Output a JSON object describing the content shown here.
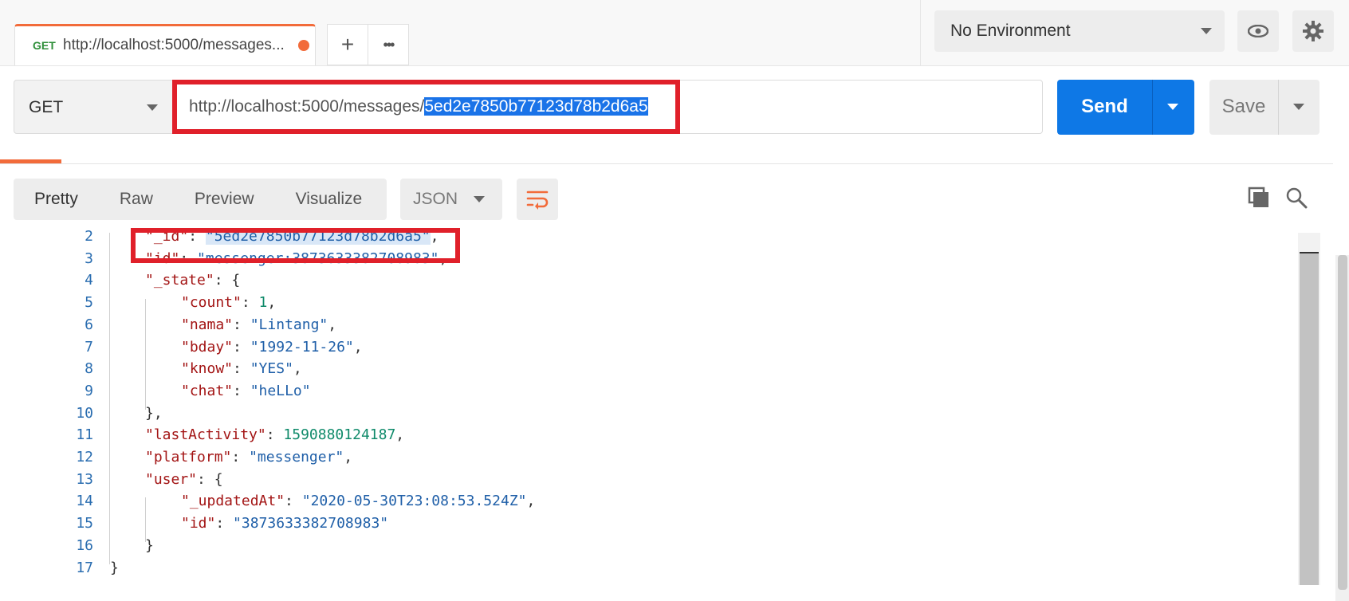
{
  "tab": {
    "method": "GET",
    "url": "http://localhost:5000/messages..."
  },
  "tab_actions": {
    "add_label": "+",
    "more_label": "•••"
  },
  "environment": {
    "selected": "No Environment"
  },
  "request": {
    "method": "GET",
    "url_base": "http://localhost:5000/messages/",
    "url_selected": "5ed2e7850b77123d78b2d6a5",
    "send_label": "Send",
    "save_label": "Save"
  },
  "response": {
    "view_tabs": [
      "Pretty",
      "Raw",
      "Preview",
      "Visualize"
    ],
    "active_view": "Pretty",
    "format": "JSON"
  },
  "code_lines": [
    {
      "num": "2",
      "parts": [
        [
          "\"_id\"",
          "k"
        ],
        [
          ": ",
          "p"
        ],
        [
          "\"5ed2e7850b77123d78b2d6a5\"",
          "s"
        ],
        [
          ",",
          "p"
        ]
      ],
      "indent": 1
    },
    {
      "num": "3",
      "parts": [
        [
          "\"id\"",
          "k"
        ],
        [
          ": ",
          "p"
        ],
        [
          "\"messenger:3873633382708983\"",
          "s"
        ],
        [
          ",",
          "p"
        ]
      ],
      "indent": 1
    },
    {
      "num": "4",
      "parts": [
        [
          "\"_state\"",
          "k"
        ],
        [
          ": {",
          "p"
        ]
      ],
      "indent": 1
    },
    {
      "num": "5",
      "parts": [
        [
          "\"count\"",
          "k"
        ],
        [
          ": ",
          "p"
        ],
        [
          "1",
          "n"
        ],
        [
          ",",
          "p"
        ]
      ],
      "indent": 2
    },
    {
      "num": "6",
      "parts": [
        [
          "\"nama\"",
          "k"
        ],
        [
          ": ",
          "p"
        ],
        [
          "\"Lintang\"",
          "s"
        ],
        [
          ",",
          "p"
        ]
      ],
      "indent": 2
    },
    {
      "num": "7",
      "parts": [
        [
          "\"bday\"",
          "k"
        ],
        [
          ": ",
          "p"
        ],
        [
          "\"1992-11-26\"",
          "s"
        ],
        [
          ",",
          "p"
        ]
      ],
      "indent": 2
    },
    {
      "num": "8",
      "parts": [
        [
          "\"know\"",
          "k"
        ],
        [
          ": ",
          "p"
        ],
        [
          "\"YES\"",
          "s"
        ],
        [
          ",",
          "p"
        ]
      ],
      "indent": 2
    },
    {
      "num": "9",
      "parts": [
        [
          "\"chat\"",
          "k"
        ],
        [
          ": ",
          "p"
        ],
        [
          "\"heLLo\"",
          "s"
        ]
      ],
      "indent": 2
    },
    {
      "num": "10",
      "parts": [
        [
          "},",
          "p"
        ]
      ],
      "indent": 1
    },
    {
      "num": "11",
      "parts": [
        [
          "\"lastActivity\"",
          "k"
        ],
        [
          ": ",
          "p"
        ],
        [
          "1590880124187",
          "n"
        ],
        [
          ",",
          "p"
        ]
      ],
      "indent": 1
    },
    {
      "num": "12",
      "parts": [
        [
          "\"platform\"",
          "k"
        ],
        [
          ": ",
          "p"
        ],
        [
          "\"messenger\"",
          "s"
        ],
        [
          ",",
          "p"
        ]
      ],
      "indent": 1
    },
    {
      "num": "13",
      "parts": [
        [
          "\"user\"",
          "k"
        ],
        [
          ": {",
          "p"
        ]
      ],
      "indent": 1
    },
    {
      "num": "14",
      "parts": [
        [
          "\"_updatedAt\"",
          "k"
        ],
        [
          ": ",
          "p"
        ],
        [
          "\"2020-05-30T23:08:53.524Z\"",
          "s"
        ],
        [
          ",",
          "p"
        ]
      ],
      "indent": 2
    },
    {
      "num": "15",
      "parts": [
        [
          "\"id\"",
          "k"
        ],
        [
          ": ",
          "p"
        ],
        [
          "\"3873633382708983\"",
          "s"
        ]
      ],
      "indent": 2
    },
    {
      "num": "16",
      "parts": [
        [
          "}",
          "p"
        ]
      ],
      "indent": 1
    },
    {
      "num": "17",
      "parts": [
        [
          "}",
          "p"
        ]
      ],
      "indent": 0
    }
  ],
  "colors": {
    "accent": "#f26b3a",
    "send": "#0e78e6",
    "highlight_box": "#e0202a"
  }
}
